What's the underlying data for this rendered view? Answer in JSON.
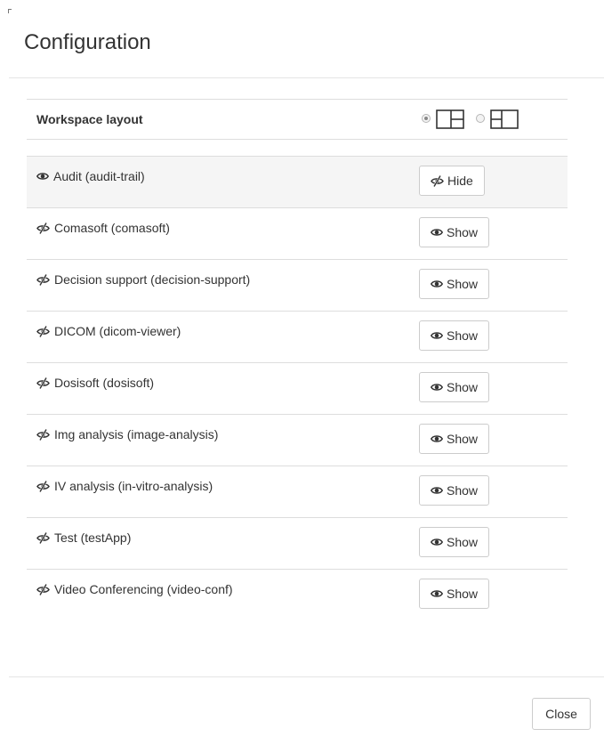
{
  "dialog": {
    "title": "Configuration"
  },
  "workspace_layout": {
    "label": "Workspace layout",
    "options": [
      {
        "icon": "layout-split-right-icon",
        "selected": true
      },
      {
        "icon": "layout-split-left-icon",
        "selected": false
      }
    ]
  },
  "apps": [
    {
      "label": "Audit (audit-trail)",
      "visible": true,
      "status_icon": "eye-icon",
      "button_label": "Hide",
      "button_icon": "eye-slash-icon",
      "highlighted": true
    },
    {
      "label": "Comasoft (comasoft)",
      "visible": false,
      "status_icon": "eye-slash-icon",
      "button_label": "Show",
      "button_icon": "eye-icon"
    },
    {
      "label": "Decision support (decision-support)",
      "visible": false,
      "status_icon": "eye-slash-icon",
      "button_label": "Show",
      "button_icon": "eye-icon"
    },
    {
      "label": "DICOM (dicom-viewer)",
      "visible": false,
      "status_icon": "eye-slash-icon",
      "button_label": "Show",
      "button_icon": "eye-icon"
    },
    {
      "label": "Dosisoft (dosisoft)",
      "visible": false,
      "status_icon": "eye-slash-icon",
      "button_label": "Show",
      "button_icon": "eye-icon"
    },
    {
      "label": "Img analysis (image-analysis)",
      "visible": false,
      "status_icon": "eye-slash-icon",
      "button_label": "Show",
      "button_icon": "eye-icon"
    },
    {
      "label": "IV analysis (in-vitro-analysis)",
      "visible": false,
      "status_icon": "eye-slash-icon",
      "button_label": "Show",
      "button_icon": "eye-icon"
    },
    {
      "label": "Test (testApp)",
      "visible": false,
      "status_icon": "eye-slash-icon",
      "button_label": "Show",
      "button_icon": "eye-icon"
    },
    {
      "label": "Video Conferencing (video-conf)",
      "visible": false,
      "status_icon": "eye-slash-icon",
      "button_label": "Show",
      "button_icon": "eye-icon"
    }
  ],
  "footer": {
    "close_label": "Close"
  },
  "colors": {
    "border": "#dddddd",
    "highlight_row": "#f5f5f5",
    "text": "#333333"
  }
}
